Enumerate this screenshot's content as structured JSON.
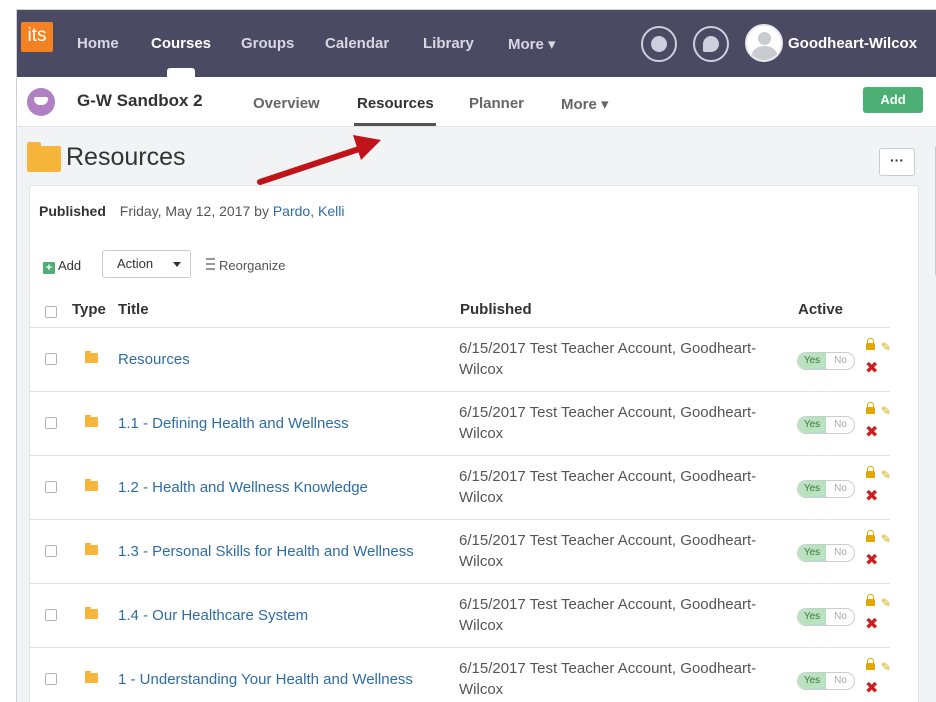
{
  "topnav": {
    "logo": "its",
    "items": [
      {
        "label": "Home",
        "active": false
      },
      {
        "label": "Courses",
        "active": true
      },
      {
        "label": "Groups",
        "active": false
      },
      {
        "label": "Calendar",
        "active": false
      },
      {
        "label": "Library",
        "active": false
      },
      {
        "label": "More ▾",
        "active": false
      }
    ],
    "user": "Goodheart-Wilcox"
  },
  "course": {
    "title": "G-W Sandbox 2",
    "tabs": [
      "Overview",
      "Resources",
      "Planner",
      "More ▾"
    ],
    "active_tab": "Resources",
    "add_label": "Add"
  },
  "page": {
    "title": "Resources",
    "options_label": "···"
  },
  "published": {
    "label": "Published",
    "date_text": "Friday, May 12, 2017 by",
    "author": "Pardo, Kelli"
  },
  "toolbar": {
    "add": "Add",
    "action": "Action",
    "reorganize": "Reorganize"
  },
  "table": {
    "headers": {
      "type": "Type",
      "title": "Title",
      "published": "Published",
      "active": "Active"
    },
    "rows": [
      {
        "title": "Resources",
        "published_line1": "6/15/2017 Test Teacher Account, Goodheart-",
        "published_line2": "Wilcox",
        "yes": "Yes",
        "no": "No"
      },
      {
        "title": "1.1 - Defining Health and Wellness",
        "published_line1": "6/15/2017 Test Teacher Account, Goodheart-",
        "published_line2": "Wilcox",
        "yes": "Yes",
        "no": "No"
      },
      {
        "title": "1.2 - Health and Wellness Knowledge",
        "published_line1": "6/15/2017 Test Teacher Account, Goodheart-",
        "published_line2": "Wilcox",
        "yes": "Yes",
        "no": "No"
      },
      {
        "title": "1.3 - Personal Skills for Health and Wellness",
        "published_line1": "6/15/2017 Test Teacher Account, Goodheart-",
        "published_line2": "Wilcox",
        "yes": "Yes",
        "no": "No"
      },
      {
        "title": "1.4 - Our Healthcare System",
        "published_line1": "6/15/2017 Test Teacher Account, Goodheart-",
        "published_line2": "Wilcox",
        "yes": "Yes",
        "no": "No"
      },
      {
        "title": "1 - Understanding Your Health and Wellness",
        "published_line1": "6/15/2017 Test Teacher Account, Goodheart-",
        "published_line2": "Wilcox",
        "yes": "Yes",
        "no": "No"
      }
    ]
  },
  "colors": {
    "topnav_bg": "#4b4a63",
    "logo": "#f58220",
    "accent_green": "#4caf73",
    "link": "#2e6da4",
    "annotation_arrow": "#c0141a"
  },
  "icons": [
    "bell-icon",
    "chat-icon",
    "avatar",
    "course-icon",
    "folder-icon",
    "lock-icon",
    "pencil-icon",
    "delete-icon"
  ]
}
